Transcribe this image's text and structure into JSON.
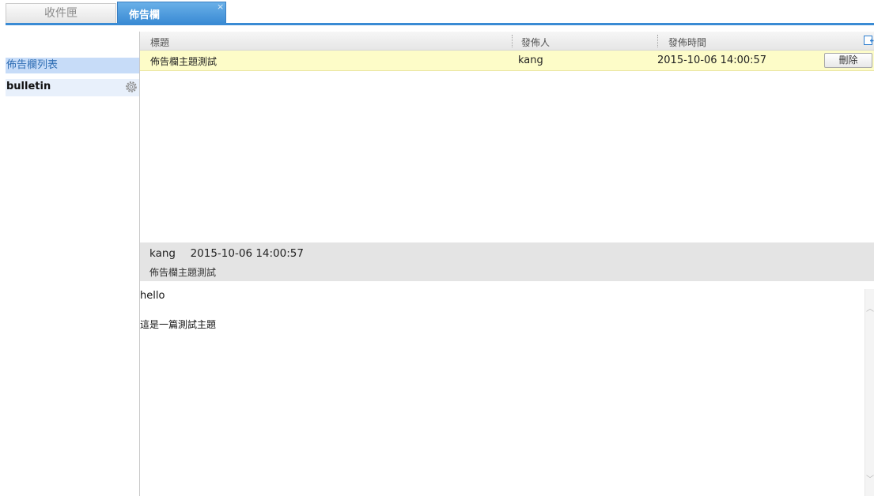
{
  "tabs": {
    "inbox_label": "收件匣",
    "bulletin_label": "佈告欄",
    "close_glyph": "×"
  },
  "sidebar": {
    "list_label": "佈告欄列表",
    "items": [
      {
        "label": "bulletin"
      }
    ]
  },
  "grid": {
    "columns": [
      "標題",
      "發佈人",
      "發佈時間"
    ],
    "rows": [
      {
        "title": "佈告欄主題測試",
        "author": "kang",
        "time": "2015-10-06 14:00:57",
        "action_label": "刪除"
      }
    ]
  },
  "detail": {
    "author": "kang",
    "time": "2015-10-06 14:00:57",
    "title": "佈告欄主題測試",
    "body": [
      "hello",
      "這是一篇測試主題"
    ]
  },
  "colors": {
    "tab_active": "#3a8bd4",
    "selected_row": "#fdfcc8",
    "sidebar_selected": "#c7dcf8"
  }
}
